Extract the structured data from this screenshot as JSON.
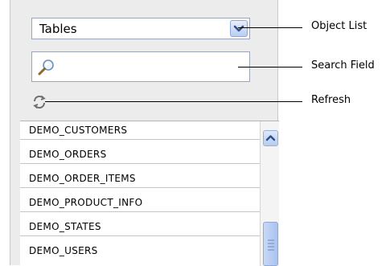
{
  "object_list": {
    "selected": "Tables"
  },
  "search": {
    "value": ""
  },
  "tables": [
    "DEMO_CUSTOMERS",
    "DEMO_ORDERS",
    "DEMO_ORDER_ITEMS",
    "DEMO_PRODUCT_INFO",
    "DEMO_STATES",
    "DEMO_USERS"
  ],
  "callouts": {
    "object_list": "Object List",
    "search_field": "Search Field",
    "refresh": "Refresh"
  },
  "icons": {
    "search": "magnifier-icon",
    "refresh": "refresh-icon",
    "dropdown": "chevron-down-icon",
    "scroll_up": "chevron-up-icon"
  },
  "colors": {
    "panel_bg": "#ececec",
    "control_blue": "#b9cdf1",
    "border": "#9aa6b5"
  }
}
